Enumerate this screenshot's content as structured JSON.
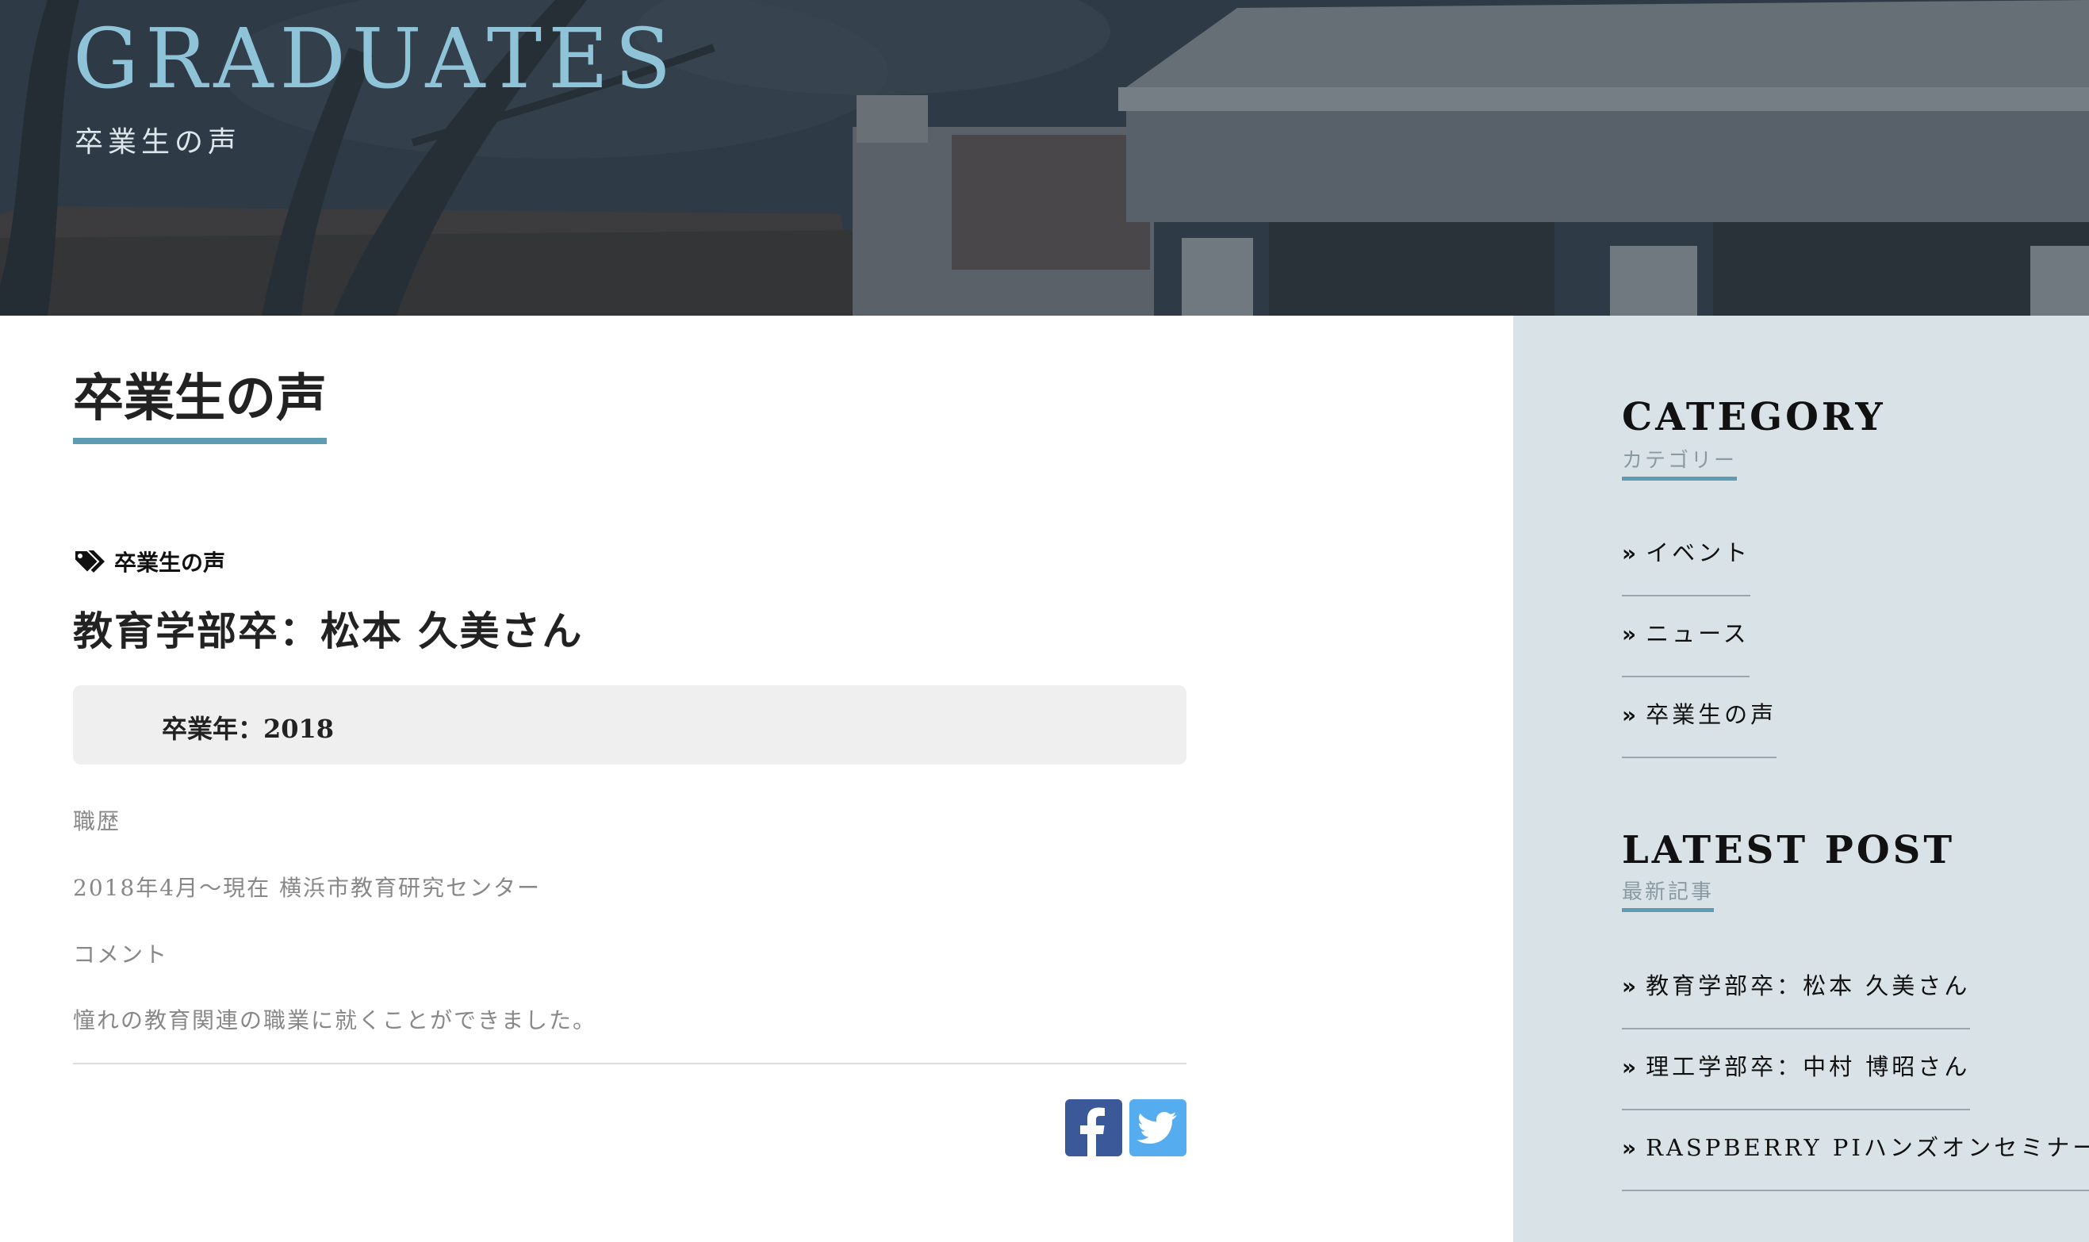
{
  "hero": {
    "title": "GRADUATES",
    "subtitle": "卒業生の声"
  },
  "main": {
    "page_title": "卒業生の声",
    "post": {
      "category_tag": "卒業生の声",
      "title": "教育学部卒：松本 久美さん",
      "graduation_year": "卒業年：2018",
      "paragraphs": [
        "職歴",
        "2018年4月～現在 横浜市教育研究センター",
        "コメント",
        "憧れの教育関連の職業に就くことができました。"
      ]
    },
    "share": {
      "facebook_icon": "facebook-icon",
      "twitter_icon": "twitter-icon"
    }
  },
  "sidebar": {
    "category": {
      "heading": "CATEGORY",
      "subheading": "カテゴリー",
      "items": [
        "イベント",
        "ニュース",
        "卒業生の声"
      ]
    },
    "latest": {
      "heading": "LATEST POST",
      "subheading": "最新記事",
      "items": [
        "教育学部卒：松本 久美さん",
        "理工学部卒：中村 博昭さん",
        "RASPBERRY PIハンズオンセミナー"
      ]
    },
    "item_icon": "double-chevron-right-icon"
  },
  "colors": {
    "accent": "#5e9cb2",
    "hero_title": "#8fc4d8",
    "sidebar_bg": "#d9e2e6",
    "facebook": "#3b5998",
    "twitter": "#55acee"
  }
}
